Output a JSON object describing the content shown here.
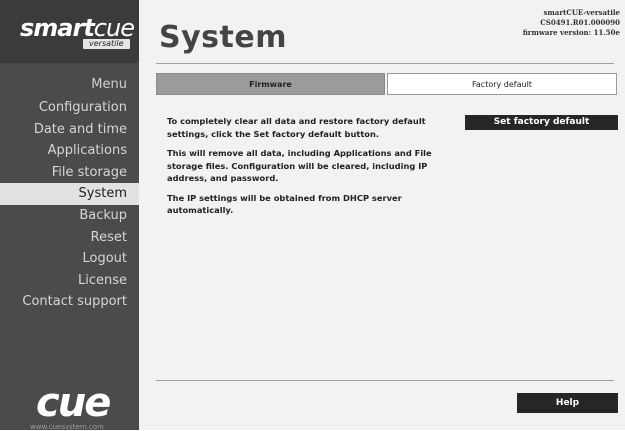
{
  "brand": {
    "logo_smart": "smart",
    "logo_cue": "cue",
    "logo_versatile": "versatile",
    "footer_logo": "cue",
    "footer_url": "www.cuesystem.com"
  },
  "header": {
    "title": "System",
    "device_name": "smartCUE-versatile",
    "serial": "CS0491.R01.000090",
    "firmware_version": "firmware version: 11.50e"
  },
  "sidebar": {
    "menu_title": "Menu",
    "items": [
      {
        "label": "Configuration",
        "active": false
      },
      {
        "label": "Date and time",
        "active": false
      },
      {
        "label": "Applications",
        "active": false
      },
      {
        "label": "File storage",
        "active": false
      },
      {
        "label": "System",
        "active": true
      },
      {
        "label": "Backup",
        "active": false
      },
      {
        "label": "Reset",
        "active": false
      },
      {
        "label": "Logout",
        "active": false
      },
      {
        "label": "License",
        "active": false
      },
      {
        "label": "Contact support",
        "active": false
      }
    ]
  },
  "tabs": {
    "firmware": "Firmware",
    "factory_default": "Factory default"
  },
  "factory": {
    "para1": "To completely clear all data and restore factory default settings, click the Set factory default button.",
    "para2": "This will remove all data, including Applications and File storage files. Configuration will be cleared, including IP address, and password.",
    "para3": "The IP settings will be obtained from DHCP server automatically.",
    "button_label": "Set factory default"
  },
  "help_label": "Help",
  "colors": {
    "sidebar_bg": "#4b4b4b",
    "content_bg": "#f2f2f2",
    "active_tab": "#9b9b9b",
    "button_bg": "#262626"
  }
}
